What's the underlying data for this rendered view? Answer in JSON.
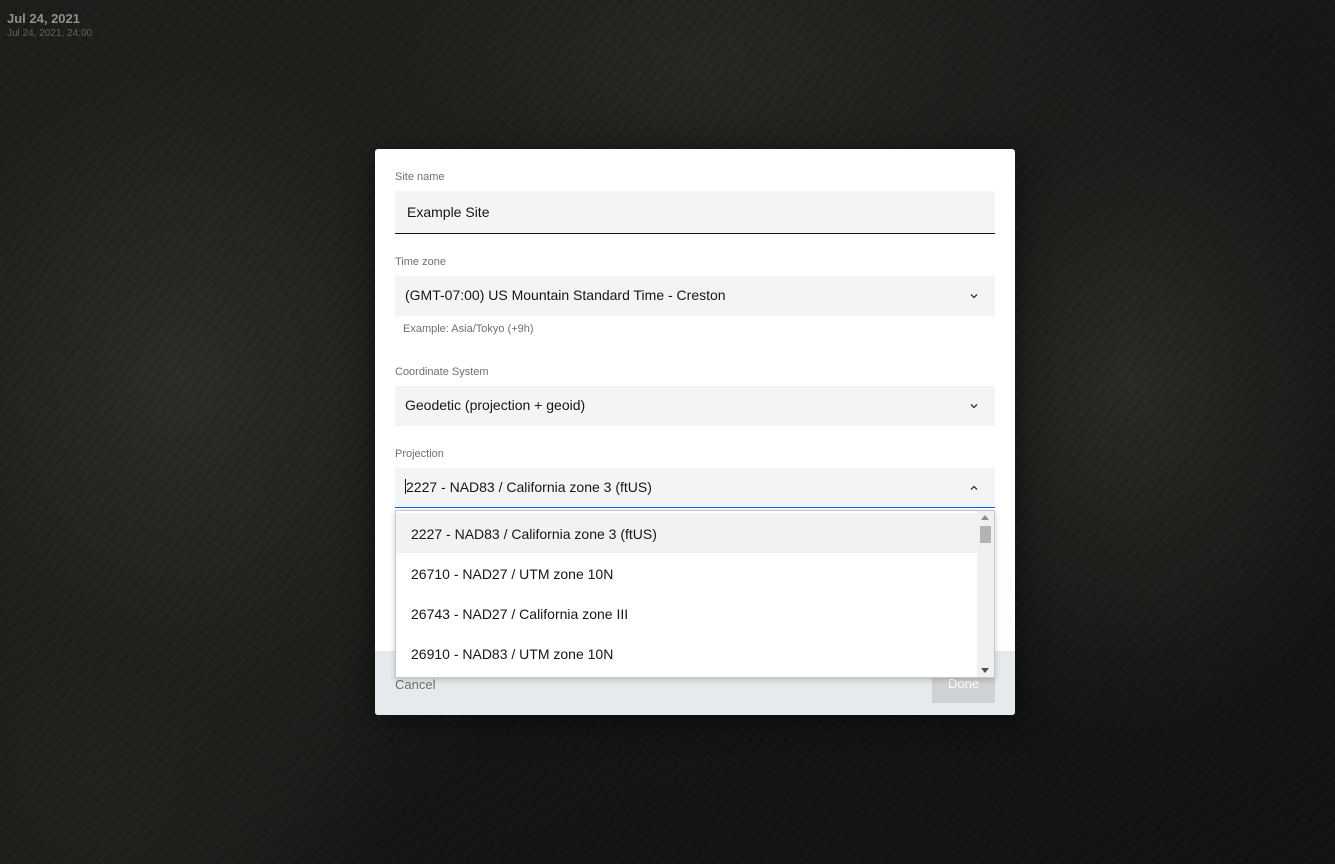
{
  "map": {
    "date": "Jul 24, 2021",
    "datetime": "Jul 24, 2021, 24:00"
  },
  "modal": {
    "site_name": {
      "label": "Site name",
      "value": "Example Site"
    },
    "time_zone": {
      "label": "Time zone",
      "value": "(GMT-07:00) US Mountain Standard Time - Creston",
      "helper": "Example: Asia/Tokyo (+9h)"
    },
    "coordinate_system": {
      "label": "Coordinate System",
      "value": "Geodetic (projection + geoid)"
    },
    "projection": {
      "label": "Projection",
      "value": "2227 - NAD83 / California zone 3 (ftUS)",
      "options": [
        "2227 - NAD83 / California zone 3 (ftUS)",
        "26710 - NAD27 / UTM zone 10N",
        "26743 - NAD27 / California zone III",
        "26910 - NAD83 / UTM zone 10N"
      ]
    },
    "footer": {
      "cancel_label": "Cancel",
      "done_label": "Done"
    }
  },
  "colors": {
    "focus_border": "#0f62fe",
    "field_bg": "#f4f4f4",
    "footer_bg": "#e7eaec",
    "done_disabled_bg": "#cfd2d4"
  },
  "icons": {
    "time_zone_chevron": "chevron-down-icon",
    "coordinate_system_chevron": "chevron-down-icon",
    "projection_chevron": "chevron-up-icon"
  }
}
